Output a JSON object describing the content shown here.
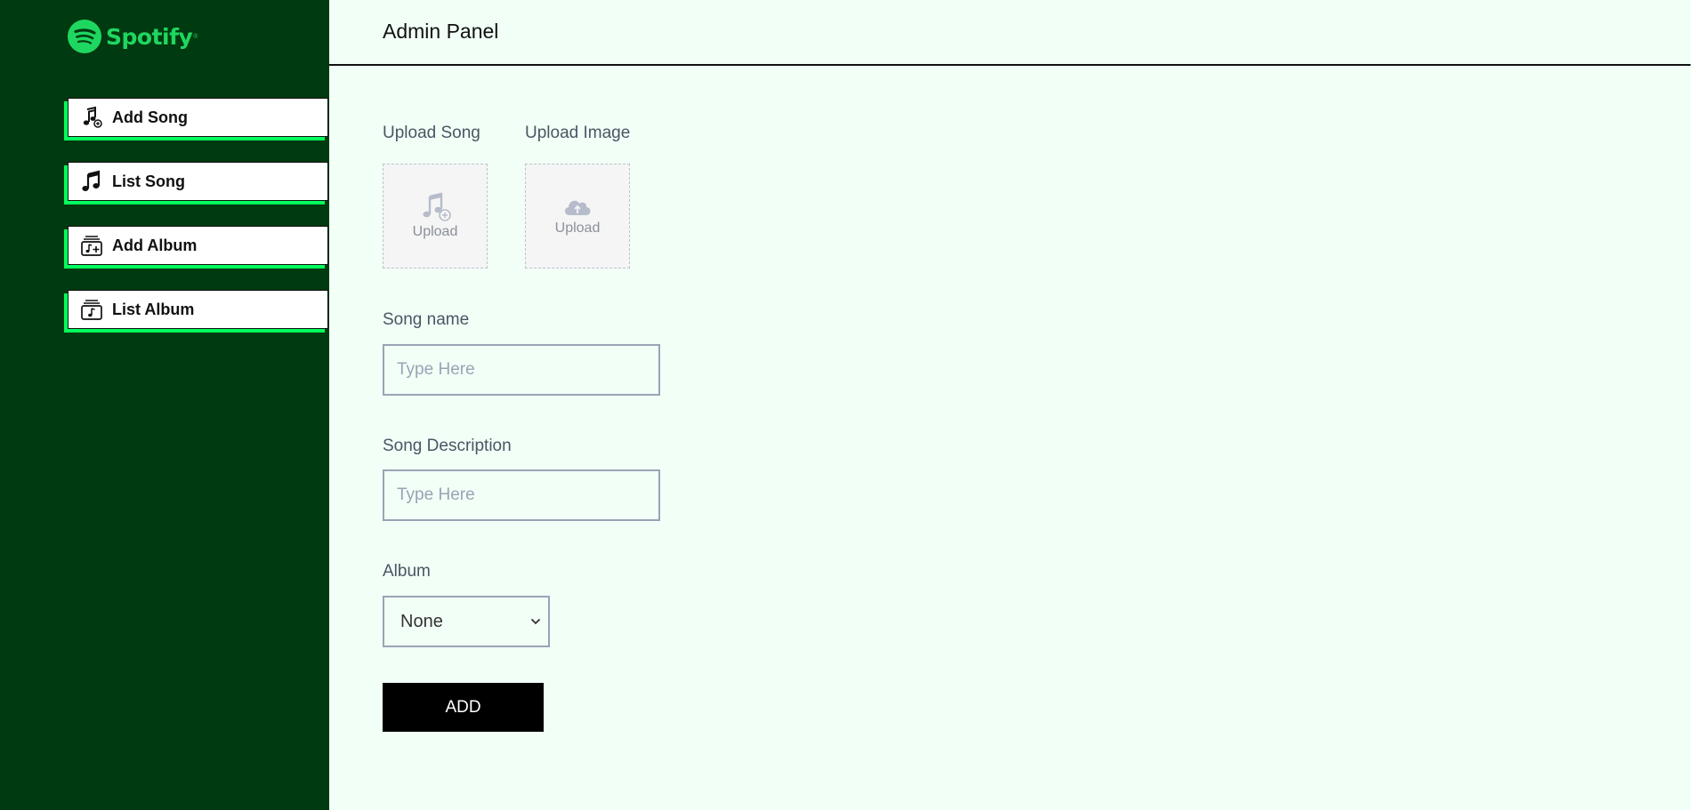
{
  "brand": {
    "name": "Spotify",
    "accent": "#1ed760",
    "sidebar_bg": "#003a10"
  },
  "sidebar": {
    "items": [
      {
        "label": "Add Song",
        "icon": "add-song-icon"
      },
      {
        "label": "List Song",
        "icon": "music-note-icon"
      },
      {
        "label": "Add Album",
        "icon": "add-album-icon"
      },
      {
        "label": "List Album",
        "icon": "album-icon"
      }
    ]
  },
  "header": {
    "title": "Admin Panel"
  },
  "form": {
    "upload_song": {
      "label": "Upload Song",
      "button_text": "Upload",
      "icon": "music-note-add-icon"
    },
    "upload_image": {
      "label": "Upload Image",
      "button_text": "Upload",
      "icon": "cloud-upload-icon"
    },
    "song_name": {
      "label": "Song name",
      "placeholder": "Type Here"
    },
    "song_description": {
      "label": "Song Description",
      "placeholder": "Type Here"
    },
    "album": {
      "label": "Album",
      "selected": "None"
    },
    "submit_label": "ADD"
  }
}
